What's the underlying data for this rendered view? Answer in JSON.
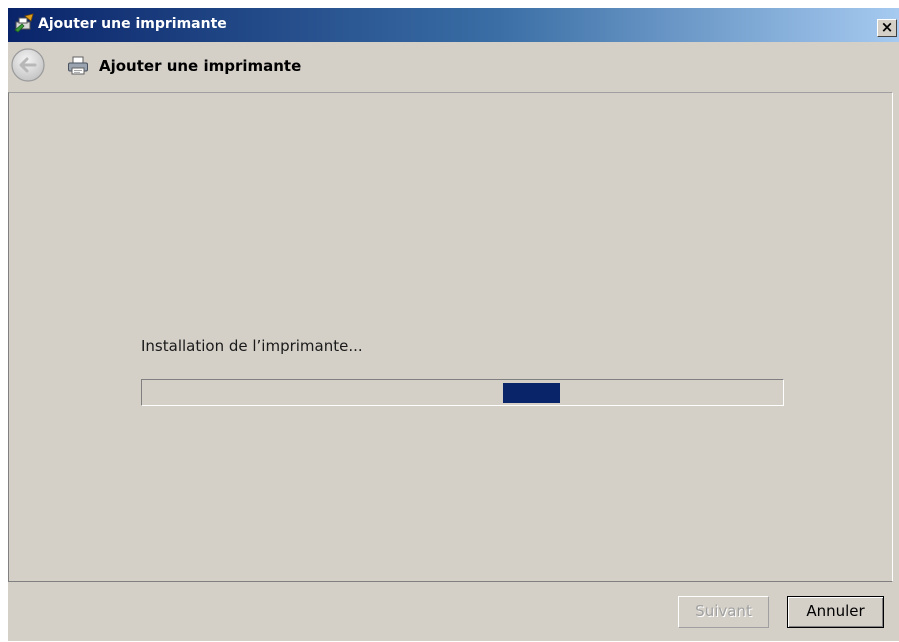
{
  "window": {
    "title": "Ajouter une imprimante",
    "close_glyph": "✕"
  },
  "nav": {
    "title": "Ajouter une imprimante",
    "back_icon": "back-arrow-icon",
    "page_icon": "printer-icon"
  },
  "main": {
    "status": "Installation de l’imprimante...",
    "progress": {
      "mode": "indeterminate",
      "chunk_color": "#0a246a"
    }
  },
  "footer": {
    "next_label": "Suivant",
    "next_enabled": false,
    "cancel_label": "Annuler"
  },
  "colors": {
    "window_bg": "#d4d0c8",
    "titlebar_start": "#0a246a",
    "titlebar_end": "#a6caf0"
  }
}
